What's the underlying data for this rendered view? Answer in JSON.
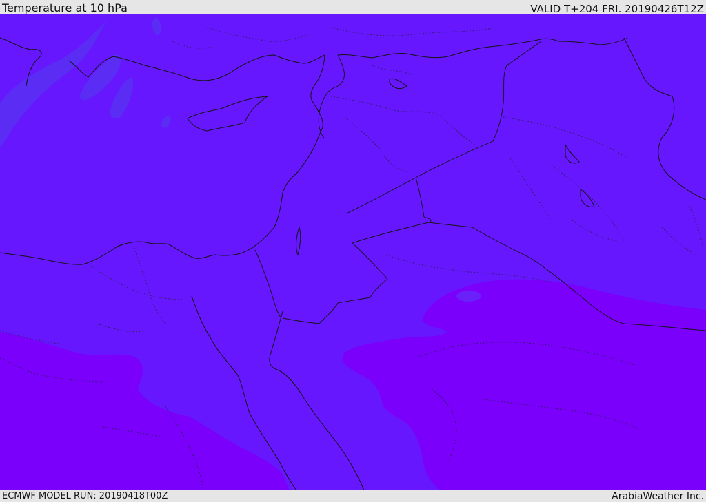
{
  "header": {
    "title": "Temperature at 10 hPa",
    "valid": "VALID T+204 FRI. 20190426T12Z"
  },
  "footer": {
    "model_run": "ECMWF MODEL RUN: 20190418T00Z",
    "credit": "ArabiaWeather Inc."
  },
  "map": {
    "colors": {
      "base_field": "#6617fd",
      "warmer_band": "#7a00fc",
      "cooler_patch": "#5a2cf4",
      "coastline": "#141414"
    }
  }
}
